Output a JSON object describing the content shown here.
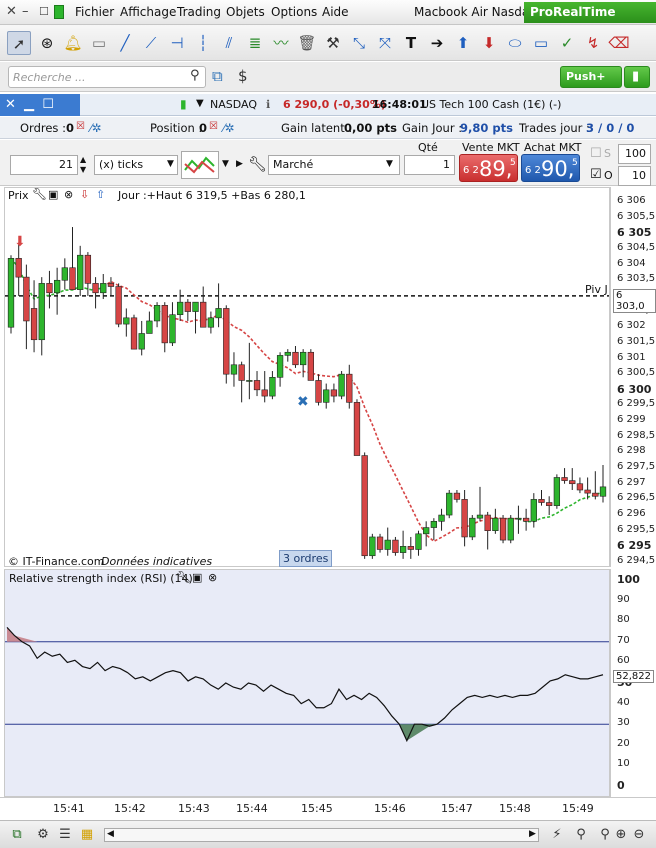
{
  "window": {
    "title": "Macbook Air Nasdaq",
    "brand": "ProRealTime Premium",
    "menu": [
      "Fichier",
      "Affichage",
      "Trading",
      "Objets",
      "Options",
      "Aide"
    ]
  },
  "search": {
    "placeholder": "Recherche ..."
  },
  "push_button": "Push+",
  "instrument_bar": {
    "symbol": "NASDAQ",
    "price": "6 290,0 (-0,30%)",
    "time": "16:48:01",
    "name": "US Tech 100 Cash (1€) (-)"
  },
  "orders_bar": {
    "ordres_label": "Ordres :",
    "ordres_value": "0",
    "position_label": "Position :",
    "position_value": "0",
    "latent_label": "Gain latent :",
    "latent_value": "0,00 pts",
    "jour_label": "Gain Jour :",
    "jour_value": "9,80 pts",
    "trades_label": "Trades jour :",
    "trades_value": "3 / 0 / 0"
  },
  "ticket": {
    "period_value": "21",
    "period_unit": "(x) ticks",
    "order_type": "Marché",
    "qty_label": "Qté",
    "qty_value": "1",
    "sell_label": "Vente MKT",
    "sell_small": "6 2",
    "sell_big": "89,",
    "sell_sup": "5",
    "buy_label": "Achat MKT",
    "buy_small": "6 2",
    "buy_big": "90,",
    "buy_sup": "5",
    "s_label": "S",
    "s_value": "100",
    "o_label": "O",
    "o_value": "10"
  },
  "price_panel": {
    "title": "Prix",
    "info": "Jour :+Haut 6 319,5 +Bas 6 280,1",
    "pivot_label": "Piv J",
    "pivot_value": "6 303,0",
    "copyright": "© IT-Finance.com",
    "indicative": "Données indicatives",
    "orders_badge": "3 ordres"
  },
  "rsi_panel": {
    "title": "Relative strength index (RSI) (14)",
    "last_value": "52,822"
  },
  "y_ticks_price": [
    {
      "label": "6 306",
      "bold": false
    },
    {
      "label": "6 305,5",
      "bold": false
    },
    {
      "label": "6 305",
      "bold": true
    },
    {
      "label": "6 304,5",
      "bold": false
    },
    {
      "label": "6 304",
      "bold": false
    },
    {
      "label": "6 303,5",
      "bold": false
    },
    {
      "label": "6 303",
      "bold": false
    },
    {
      "label": "6 302,5",
      "bold": false
    },
    {
      "label": "6 302",
      "bold": false
    },
    {
      "label": "6 301,5",
      "bold": false
    },
    {
      "label": "6 301",
      "bold": false
    },
    {
      "label": "6 300,5",
      "bold": false
    },
    {
      "label": "6 300",
      "bold": true
    },
    {
      "label": "6 299,5",
      "bold": false
    },
    {
      "label": "6 299",
      "bold": false
    },
    {
      "label": "6 298,5",
      "bold": false
    },
    {
      "label": "6 298",
      "bold": false
    },
    {
      "label": "6 297,5",
      "bold": false
    },
    {
      "label": "6 297",
      "bold": false
    },
    {
      "label": "6 296,5",
      "bold": false
    },
    {
      "label": "6 296",
      "bold": false
    },
    {
      "label": "6 295,5",
      "bold": false
    },
    {
      "label": "6 295",
      "bold": true
    },
    {
      "label": "6 294,5",
      "bold": false
    }
  ],
  "y_ticks_rsi": [
    {
      "label": "100",
      "bold": true
    },
    {
      "label": "90",
      "bold": false
    },
    {
      "label": "80",
      "bold": false
    },
    {
      "label": "70",
      "bold": false
    },
    {
      "label": "60",
      "bold": false
    },
    {
      "label": "50",
      "bold": true
    },
    {
      "label": "40",
      "bold": false
    },
    {
      "label": "30",
      "bold": false
    },
    {
      "label": "20",
      "bold": false
    },
    {
      "label": "10",
      "bold": false
    },
    {
      "label": "0",
      "bold": true
    }
  ],
  "x_ticks": [
    "15:41",
    "15:42",
    "15:43",
    "15:44",
    "15:45",
    "15:46",
    "15:47",
    "15:48",
    "15:49"
  ],
  "chart_data": [
    {
      "type": "candlestick",
      "title": "Prix",
      "x_categories": [
        "15:41",
        "15:42",
        "15:43",
        "15:44",
        "15:45",
        "15:46",
        "15:47",
        "15:48",
        "15:49"
      ],
      "ylim": [
        6294.5,
        6306
      ],
      "pivot": 6303.0,
      "candles": [
        {
          "o": 6302,
          "h": 6304.3,
          "l": 6301.8,
          "c": 6304.2
        },
        {
          "o": 6304.2,
          "h": 6304.7,
          "l": 6303,
          "c": 6303.6
        },
        {
          "o": 6303.6,
          "h": 6304,
          "l": 6301.3,
          "c": 6302.2
        },
        {
          "o": 6302.6,
          "h": 6303.5,
          "l": 6301.2,
          "c": 6301.6
        },
        {
          "o": 6301.6,
          "h": 6303.6,
          "l": 6301.1,
          "c": 6303.4
        },
        {
          "o": 6303.4,
          "h": 6303.8,
          "l": 6302.6,
          "c": 6303.1
        },
        {
          "o": 6303.1,
          "h": 6303.9,
          "l": 6302.4,
          "c": 6303.5
        },
        {
          "o": 6303.5,
          "h": 6304.2,
          "l": 6303.2,
          "c": 6303.9
        },
        {
          "o": 6303.9,
          "h": 6305.2,
          "l": 6303.5,
          "c": 6303.2
        },
        {
          "o": 6303.2,
          "h": 6304.6,
          "l": 6303,
          "c": 6304.3
        },
        {
          "o": 6304.3,
          "h": 6304.4,
          "l": 6303,
          "c": 6303.4
        },
        {
          "o": 6303.4,
          "h": 6303.6,
          "l": 6302.6,
          "c": 6303.1
        },
        {
          "o": 6303.1,
          "h": 6303.7,
          "l": 6302.9,
          "c": 6303.4
        },
        {
          "o": 6303.4,
          "h": 6303.6,
          "l": 6303,
          "c": 6303.3
        },
        {
          "o": 6303.3,
          "h": 6303.4,
          "l": 6302,
          "c": 6302.1
        },
        {
          "o": 6302.1,
          "h": 6302.6,
          "l": 6301.7,
          "c": 6302.3
        },
        {
          "o": 6302.3,
          "h": 6302.4,
          "l": 6301.3,
          "c": 6301.3
        },
        {
          "o": 6301.3,
          "h": 6302.2,
          "l": 6301.1,
          "c": 6301.8
        },
        {
          "o": 6301.8,
          "h": 6302.5,
          "l": 6301.8,
          "c": 6302.2
        },
        {
          "o": 6302.2,
          "h": 6302.8,
          "l": 6302,
          "c": 6302.7
        },
        {
          "o": 6302.7,
          "h": 6302.8,
          "l": 6301.2,
          "c": 6301.5
        },
        {
          "o": 6301.5,
          "h": 6302.8,
          "l": 6301.4,
          "c": 6302.4
        },
        {
          "o": 6302.4,
          "h": 6303.2,
          "l": 6302.2,
          "c": 6302.8
        },
        {
          "o": 6302.8,
          "h": 6302.9,
          "l": 6302.2,
          "c": 6302.5
        },
        {
          "o": 6302.5,
          "h": 6302.8,
          "l": 6301.8,
          "c": 6302.8
        },
        {
          "o": 6302.8,
          "h": 6303.3,
          "l": 6302,
          "c": 6302
        },
        {
          "o": 6302,
          "h": 6302.5,
          "l": 6301.8,
          "c": 6302.3
        },
        {
          "o": 6302.3,
          "h": 6303.4,
          "l": 6302,
          "c": 6302.6
        },
        {
          "o": 6302.6,
          "h": 6302.7,
          "l": 6300.2,
          "c": 6300.5
        },
        {
          "o": 6300.5,
          "h": 6301.2,
          "l": 6300.1,
          "c": 6300.8
        },
        {
          "o": 6300.8,
          "h": 6300.9,
          "l": 6299.6,
          "c": 6300.3
        },
        {
          "o": 6300.3,
          "h": 6301.5,
          "l": 6299.7,
          "c": 6300.3
        },
        {
          "o": 6300.3,
          "h": 6300.6,
          "l": 6299.8,
          "c": 6300
        },
        {
          "o": 6300,
          "h": 6300.6,
          "l": 6299.6,
          "c": 6299.8
        },
        {
          "o": 6299.8,
          "h": 6300.6,
          "l": 6299.7,
          "c": 6300.4
        },
        {
          "o": 6300.4,
          "h": 6301.2,
          "l": 6300.1,
          "c": 6301.1
        },
        {
          "o": 6301.1,
          "h": 6301.3,
          "l": 6300.9,
          "c": 6301.2
        },
        {
          "o": 6301.2,
          "h": 6301.4,
          "l": 6300.7,
          "c": 6300.8
        },
        {
          "o": 6300.8,
          "h": 6301.3,
          "l": 6300.4,
          "c": 6301.2
        },
        {
          "o": 6301.2,
          "h": 6301.3,
          "l": 6300.3,
          "c": 6300.3
        },
        {
          "o": 6300.3,
          "h": 6300.5,
          "l": 6299.5,
          "c": 6299.6
        },
        {
          "o": 6299.6,
          "h": 6300.2,
          "l": 6299.4,
          "c": 6300
        },
        {
          "o": 6300,
          "h": 6300.2,
          "l": 6299.6,
          "c": 6299.8
        },
        {
          "o": 6299.8,
          "h": 6300.6,
          "l": 6299.7,
          "c": 6300.5
        },
        {
          "o": 6300.5,
          "h": 6300.8,
          "l": 6299.4,
          "c": 6299.6
        },
        {
          "o": 6299.6,
          "h": 6299.7,
          "l": 6297.9,
          "c": 6297.9
        },
        {
          "o": 6297.9,
          "h": 6298,
          "l": 6294.6,
          "c": 6294.7
        },
        {
          "o": 6294.7,
          "h": 6295.4,
          "l": 6294.6,
          "c": 6295.3
        },
        {
          "o": 6295.3,
          "h": 6295.4,
          "l": 6294.8,
          "c": 6294.9
        },
        {
          "o": 6294.9,
          "h": 6295.6,
          "l": 6294.7,
          "c": 6295.2
        },
        {
          "o": 6295.2,
          "h": 6295.3,
          "l": 6294.7,
          "c": 6294.8
        },
        {
          "o": 6294.8,
          "h": 6295.5,
          "l": 6294.6,
          "c": 6295.0
        },
        {
          "o": 6295.0,
          "h": 6295.3,
          "l": 6294.6,
          "c": 6294.9
        },
        {
          "o": 6294.9,
          "h": 6295.5,
          "l": 6294.7,
          "c": 6295.4
        },
        {
          "o": 6295.4,
          "h": 6295.8,
          "l": 6295.0,
          "c": 6295.6
        },
        {
          "o": 6295.6,
          "h": 6295.9,
          "l": 6295.2,
          "c": 6295.8
        },
        {
          "o": 6295.8,
          "h": 6296.2,
          "l": 6295.5,
          "c": 6296.0
        },
        {
          "o": 6296.0,
          "h": 6296.8,
          "l": 6295.9,
          "c": 6296.7
        },
        {
          "o": 6296.7,
          "h": 6296.8,
          "l": 6296.4,
          "c": 6296.5
        },
        {
          "o": 6296.5,
          "h": 6296.8,
          "l": 6295.0,
          "c": 6295.3
        },
        {
          "o": 6295.3,
          "h": 6296.0,
          "l": 6295.2,
          "c": 6295.9
        },
        {
          "o": 6295.9,
          "h": 6296.9,
          "l": 6295.8,
          "c": 6296.0
        },
        {
          "o": 6296.0,
          "h": 6296.1,
          "l": 6294.9,
          "c": 6295.5
        },
        {
          "o": 6295.5,
          "h": 6296.2,
          "l": 6295.4,
          "c": 6295.9
        },
        {
          "o": 6295.9,
          "h": 6296.0,
          "l": 6295.1,
          "c": 6295.2
        },
        {
          "o": 6295.2,
          "h": 6296.0,
          "l": 6295.1,
          "c": 6295.9
        },
        {
          "o": 6295.9,
          "h": 6296.3,
          "l": 6295.4,
          "c": 6295.9
        },
        {
          "o": 6295.9,
          "h": 6296.2,
          "l": 6295.5,
          "c": 6295.8
        },
        {
          "o": 6295.8,
          "h": 6296.7,
          "l": 6295.6,
          "c": 6296.5
        },
        {
          "o": 6296.5,
          "h": 6296.8,
          "l": 6296.3,
          "c": 6296.4
        },
        {
          "o": 6296.4,
          "h": 6296.6,
          "l": 6296.0,
          "c": 6296.3
        },
        {
          "o": 6296.3,
          "h": 6297.3,
          "l": 6296.2,
          "c": 6297.2
        },
        {
          "o": 6297.2,
          "h": 6297.5,
          "l": 6297.0,
          "c": 6297.1
        },
        {
          "o": 6297.1,
          "h": 6297.5,
          "l": 6296.8,
          "c": 6297.0
        },
        {
          "o": 6297.0,
          "h": 6297.2,
          "l": 6296.7,
          "c": 6296.8
        },
        {
          "o": 6296.8,
          "h": 6297.2,
          "l": 6296.5,
          "c": 6296.7
        },
        {
          "o": 6296.7,
          "h": 6297.4,
          "l": 6296.5,
          "c": 6296.6
        },
        {
          "o": 6296.6,
          "h": 6297.6,
          "l": 6296.4,
          "c": 6296.9
        }
      ],
      "colors": {
        "up": "#2db52d",
        "down": "#d64545"
      }
    },
    {
      "type": "line",
      "title": "Relative strength index (RSI) (14)",
      "ylim": [
        0,
        100
      ],
      "levels": [
        70,
        30
      ],
      "values": [
        77,
        73,
        70,
        68,
        62,
        65,
        63,
        64,
        60,
        61,
        58,
        57,
        60,
        56,
        58,
        57,
        55,
        52,
        53,
        51,
        53,
        55,
        56,
        55,
        51,
        53,
        52,
        49,
        47,
        50,
        48,
        47,
        50,
        49,
        46,
        49,
        47,
        45,
        44,
        40,
        42,
        38,
        38,
        40,
        47,
        42,
        44,
        42,
        45,
        43,
        39,
        34,
        30,
        22,
        30,
        30,
        29,
        30,
        33,
        37,
        40,
        43,
        44,
        43,
        44,
        43,
        44,
        43,
        44,
        44,
        45,
        48,
        51,
        52,
        54,
        53,
        52,
        52,
        53,
        54
      ]
    }
  ]
}
